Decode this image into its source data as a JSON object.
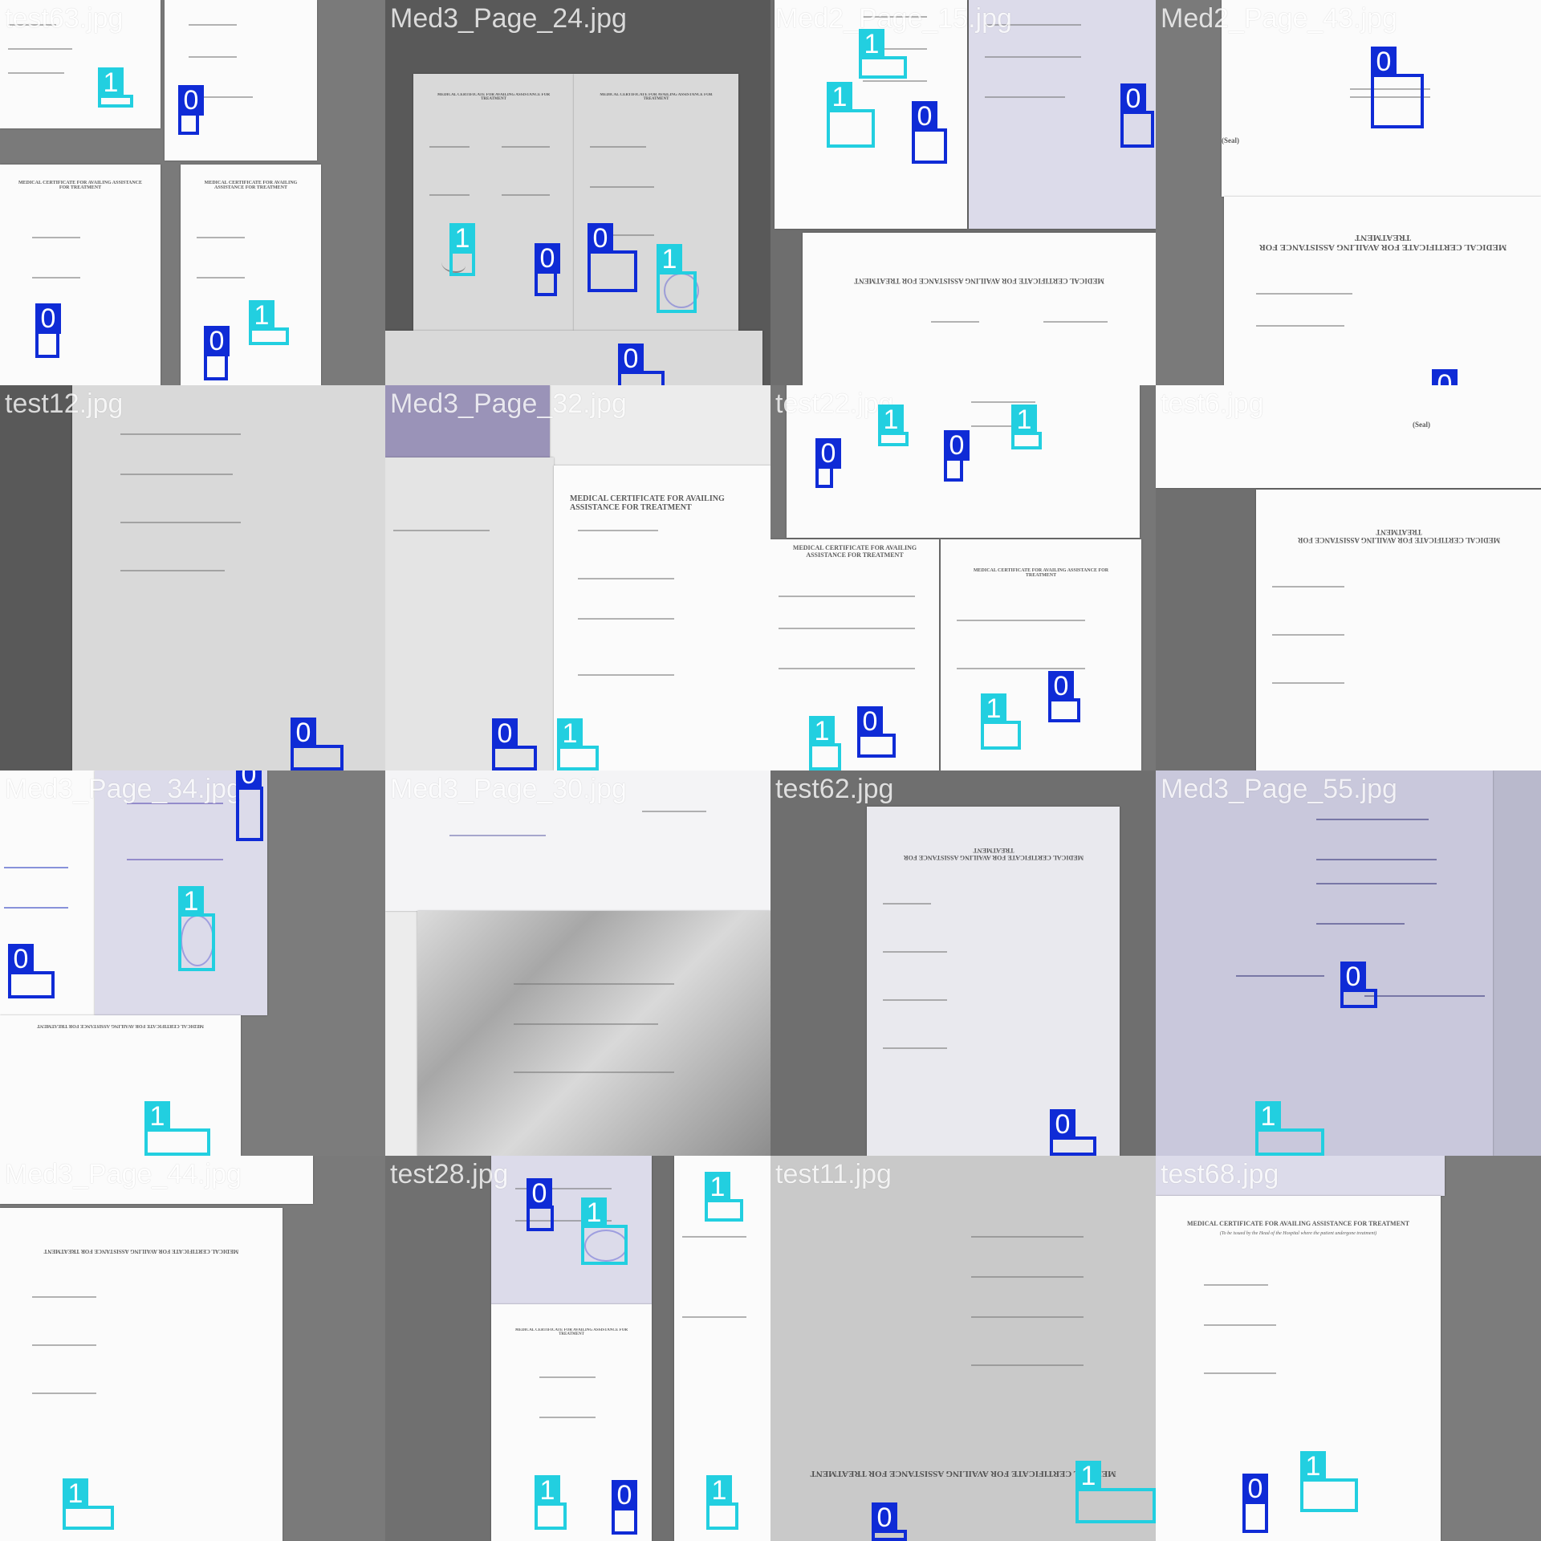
{
  "image": {
    "type": "object detection validation mosaic",
    "class_colors": {
      "0": "#0f2bd6",
      "1": "#22cfe0"
    }
  },
  "tiles": [
    {
      "filename": "test63.jpg",
      "labels": [
        "1",
        "0",
        "0",
        "0",
        "1"
      ]
    },
    {
      "filename": "Med3_Page_24.jpg",
      "labels": [
        "1",
        "0",
        "0",
        "1",
        "0"
      ]
    },
    {
      "filename": "Med2_Page_15.jpg",
      "labels": [
        "1",
        "1",
        "0",
        "0"
      ]
    },
    {
      "filename": "Med2_Page_43.jpg",
      "labels": [
        "0",
        "0"
      ]
    },
    {
      "filename": "test12.jpg",
      "labels": [
        "0"
      ]
    },
    {
      "filename": "Med3_Page_32.jpg",
      "labels": [
        "0",
        "1"
      ]
    },
    {
      "filename": "test22.jpg",
      "labels": [
        "1",
        "0",
        "0",
        "1",
        "1",
        "0",
        "1",
        "0"
      ]
    },
    {
      "filename": "test6.jpg",
      "labels": []
    },
    {
      "filename": "Med3_Page_34.jpg",
      "labels": [
        "0",
        "1",
        "0",
        "1"
      ]
    },
    {
      "filename": "Med3_Page_30.jpg",
      "labels": []
    },
    {
      "filename": "test62.jpg",
      "labels": [
        "0"
      ]
    },
    {
      "filename": "Med3_Page_55.jpg",
      "labels": [
        "0",
        "1"
      ]
    },
    {
      "filename": "Med3_Page_44.jpg",
      "labels": [
        "1"
      ]
    },
    {
      "filename": "test28.jpg",
      "labels": [
        "0",
        "1",
        "1",
        "1",
        "0",
        "1"
      ]
    },
    {
      "filename": "test11.jpg",
      "labels": [
        "1",
        "0"
      ]
    },
    {
      "filename": "test68.jpg",
      "labels": [
        "1",
        "0"
      ]
    }
  ],
  "doc_text": {
    "title": "MEDICAL CERTIFICATE FOR AVAILING ASSISTANCE FOR TREATMENT",
    "subtitle": "(To be issued by the Head of the Hospital where the patient undergone treatment)",
    "seal": "(Seal)"
  }
}
